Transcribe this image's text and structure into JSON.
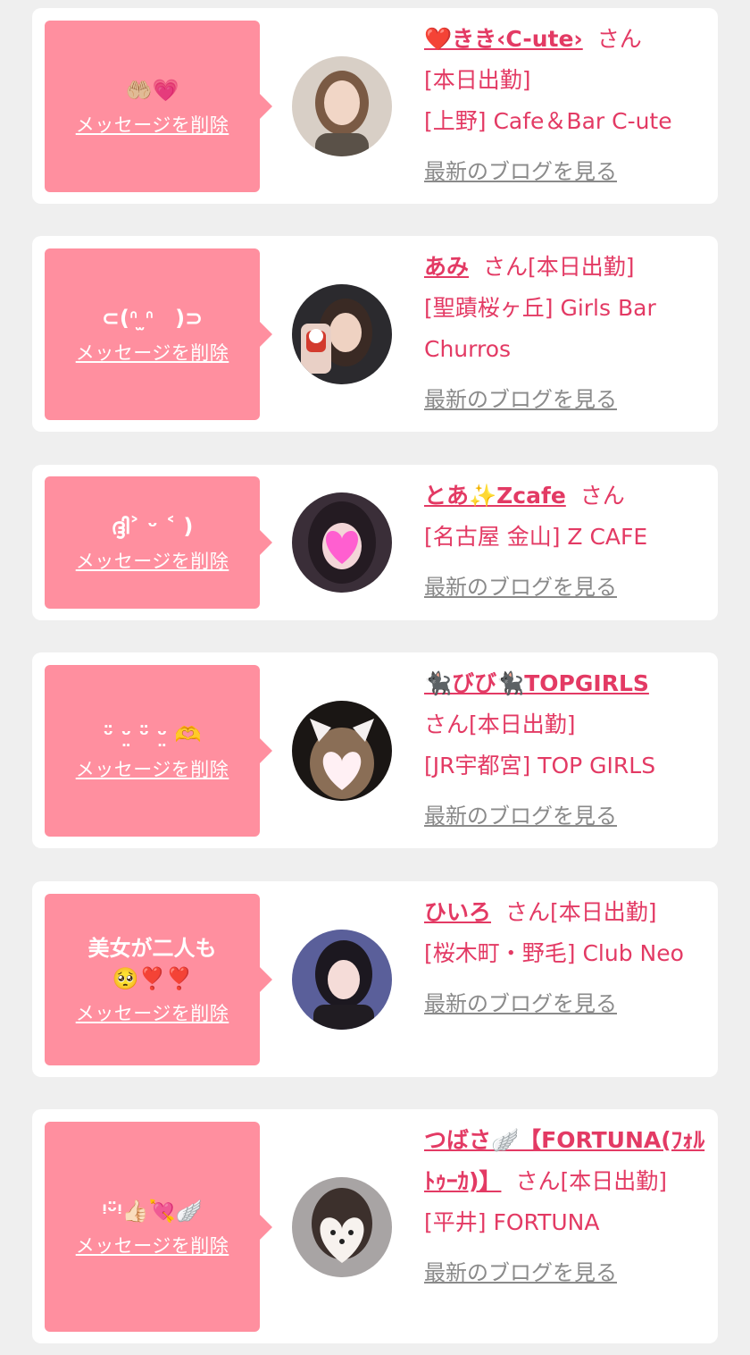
{
  "delete_label": "メッセージを削除",
  "blog_label": "最新のブログを見る",
  "san_label": "さん",
  "colors": {
    "background": "#efefef",
    "card": "#ffffff",
    "bubble": "#ff8f9f",
    "accent": "#e33a64",
    "link_gray": "#8a8a8a"
  },
  "cards": [
    {
      "message": "🤲🏼💗",
      "name": "❤️きき‹C-ute›",
      "status": "[本日出勤]",
      "shop": "[上野] Cafe＆Bar C-ute",
      "avatar_icon": "woman-portrait-icon"
    },
    {
      "message": "⊂(ᐢ ̫ᐢ　)⊃",
      "name": "あみ",
      "status": "[本日出勤]",
      "shop": "[聖蹟桜ヶ丘] Girls Bar Churros",
      "avatar_icon": "woman-portrait-icon"
    },
    {
      "message": "ദ്ദി˃ ᵕ ˂ )",
      "name": "とあ✨Zcafe",
      "status": "",
      "shop": "[名古屋 金山] Z CAFE",
      "avatar_icon": "woman-portrait-icon"
    },
    {
      "message": "ᵕ̈ ᵕ̤ ᵕ̈ ᵕ̤ 🫶",
      "name": "🐈‍⬛びび🐈‍⬛TOPGIRLS",
      "status": "[本日出勤]",
      "shop": "[JR宇都宮] TOP GIRLS",
      "avatar_icon": "woman-portrait-icon"
    },
    {
      "message": "美女が二人も🥺❣️❣️",
      "name": "ひいろ",
      "status": "[本日出勤]",
      "shop": "[桜木町・野毛] Club Neo",
      "avatar_icon": "woman-portrait-icon"
    },
    {
      "message": "ᵎᵕ̈ᵎ👍🏻💘🪽",
      "name": "つばさ🪽【FORTUNA(ﾌｫﾙﾄｩｰｶ)】",
      "status": "[本日出勤]",
      "shop": "[平井] FORTUNA",
      "avatar_icon": "woman-portrait-icon"
    }
  ]
}
